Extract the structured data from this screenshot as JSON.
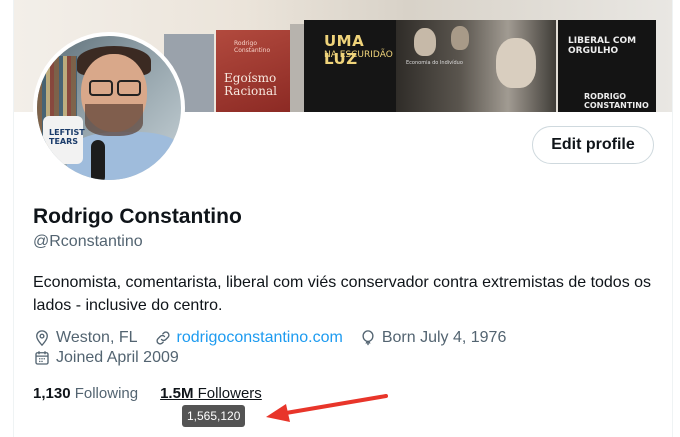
{
  "banner": {
    "books": {
      "red_spine_small": "Rodrigo Constantino",
      "red_title": "Egoísmo Racional",
      "dark1_title": "UMA LUZ",
      "dark1_subtitle": "NA ESCURIDÃO",
      "faces_title": "Economia do Indivíduo",
      "dark2_title": "LIBERAL COM ORGULHO",
      "dark2_author": "RODRIGO CONSTANTINO"
    },
    "mug_text": "LEFTIST TEARS"
  },
  "profile": {
    "edit_label": "Edit profile",
    "name": "Rodrigo Constantino",
    "handle": "@Rconstantino",
    "bio": "Economista, comentarista, liberal com viés conservador contra extremistas de todos os lados - inclusive do centro.",
    "location": "Weston, FL",
    "website": "rodrigoconstantino.com",
    "birthday": "Born July 4, 1976",
    "joined": "Joined April 2009",
    "following_count": "1,130",
    "following_label": "Following",
    "followers_count": "1.5M",
    "followers_label": "Followers",
    "followers_tooltip": "1,565,120"
  },
  "colors": {
    "link": "#1d9bf0",
    "secondary_text": "#536471",
    "arrow": "#e8352a"
  },
  "icons": [
    "location-icon",
    "link-icon",
    "balloon-icon",
    "calendar-icon"
  ]
}
